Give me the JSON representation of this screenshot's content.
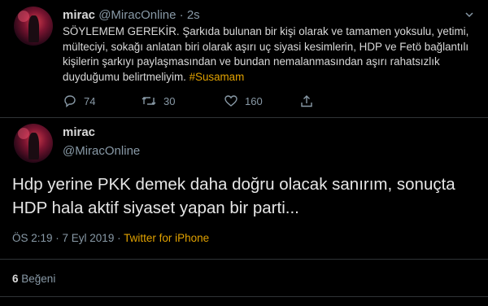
{
  "tweet1": {
    "display_name": "mirac",
    "handle": "@MiracOnline",
    "separator": "·",
    "time": "2s",
    "text": "SÖYLEMEM GEREKİR. Şarkıda bulunan bir kişi olarak ve tamamen yoksulu, yetimi, mülteciyi, sokağı anlatan biri olarak aşırı uç siyasi kesimlerin, HDP ve Fetö bağlantılı kişilerin şarkıyı paylaşmasından ve bundan nemalanmasından aşırı rahatsızlık duyduğumu belirtmeliyim.",
    "hashtag": "#Susamam",
    "replies": "74",
    "retweets": "30",
    "likes": "160",
    "icons": [
      "reply-icon",
      "retweet-icon",
      "like-icon",
      "share-icon",
      "chevron-down-icon"
    ]
  },
  "tweet2": {
    "display_name": "mirac",
    "handle": "@MiracOnline",
    "text": "Hdp yerine PKK demek daha doğru olacak sanırım, sonuçta HDP hala aktif siyaset yapan bir parti...",
    "timestamp": "ÖS 2:19 · 7 Eyl 2019 ·",
    "source": "Twitter for iPhone",
    "like_count": "6",
    "like_label": "Beğeni"
  },
  "colors": {
    "background": "#000000",
    "text": "#d9d9d9",
    "secondary": "#8899a6",
    "accent": "#e0a100",
    "divider": "#2f3336"
  }
}
